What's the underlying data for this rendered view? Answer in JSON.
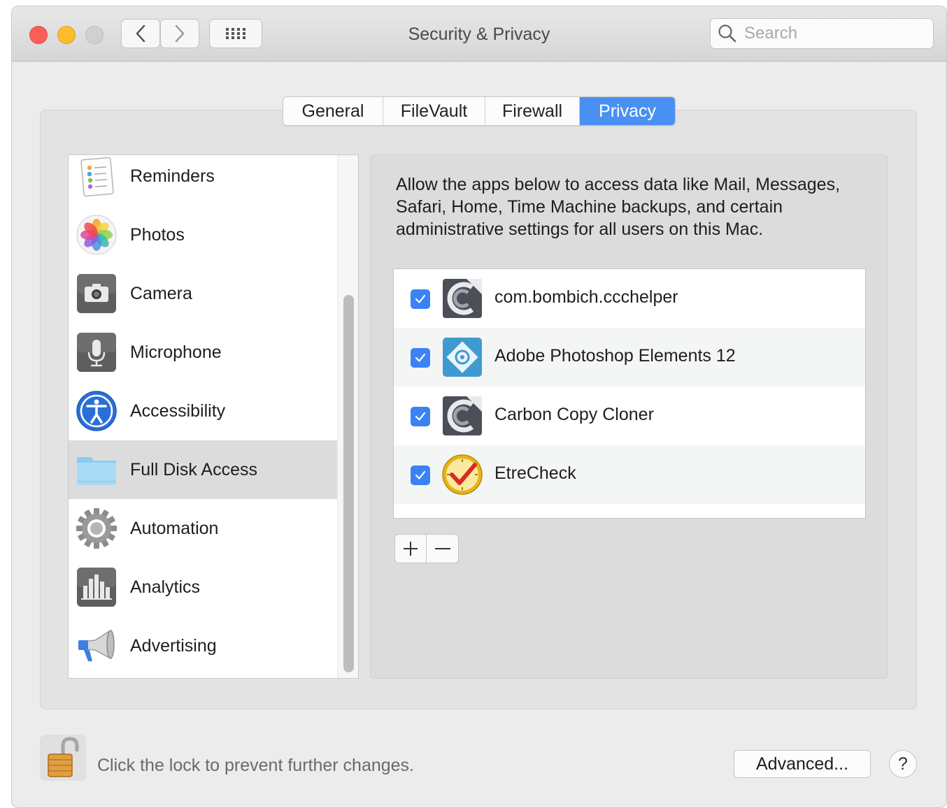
{
  "window": {
    "title": "Security & Privacy"
  },
  "search": {
    "placeholder": "Search"
  },
  "tabs": [
    {
      "label": "General"
    },
    {
      "label": "FileVault"
    },
    {
      "label": "Firewall"
    },
    {
      "label": "Privacy",
      "active": true
    }
  ],
  "sidebar": {
    "items": [
      {
        "label": "Reminders",
        "icon": "reminders-icon"
      },
      {
        "label": "Photos",
        "icon": "photos-icon"
      },
      {
        "label": "Camera",
        "icon": "camera-icon"
      },
      {
        "label": "Microphone",
        "icon": "microphone-icon"
      },
      {
        "label": "Accessibility",
        "icon": "accessibility-icon"
      },
      {
        "label": "Full Disk Access",
        "icon": "folder-icon",
        "selected": true
      },
      {
        "label": "Automation",
        "icon": "gear-icon"
      },
      {
        "label": "Analytics",
        "icon": "analytics-icon"
      },
      {
        "label": "Advertising",
        "icon": "megaphone-icon"
      }
    ]
  },
  "main": {
    "description": "Allow the apps below to access data like Mail, Messages, Safari, Home, Time Machine backups, and certain administrative settings for all users on this Mac.",
    "apps": [
      {
        "name": "com.bombich.ccchelper",
        "checked": true,
        "icon": "ccc-icon"
      },
      {
        "name": "Adobe Photoshop Elements 12",
        "checked": true,
        "icon": "photoshop-elements-icon"
      },
      {
        "name": "Carbon Copy Cloner",
        "checked": true,
        "icon": "ccc-icon"
      },
      {
        "name": "EtreCheck",
        "checked": true,
        "icon": "etrecheck-icon"
      }
    ],
    "add_label": "+",
    "remove_label": "−"
  },
  "footer": {
    "lock_text": "Click the lock to prevent further changes.",
    "advanced_label": "Advanced...",
    "help_label": "?"
  },
  "colors": {
    "accent": "#4a90f2",
    "checkbox": "#3b82f6",
    "selected_row": "#dcdcdc"
  }
}
